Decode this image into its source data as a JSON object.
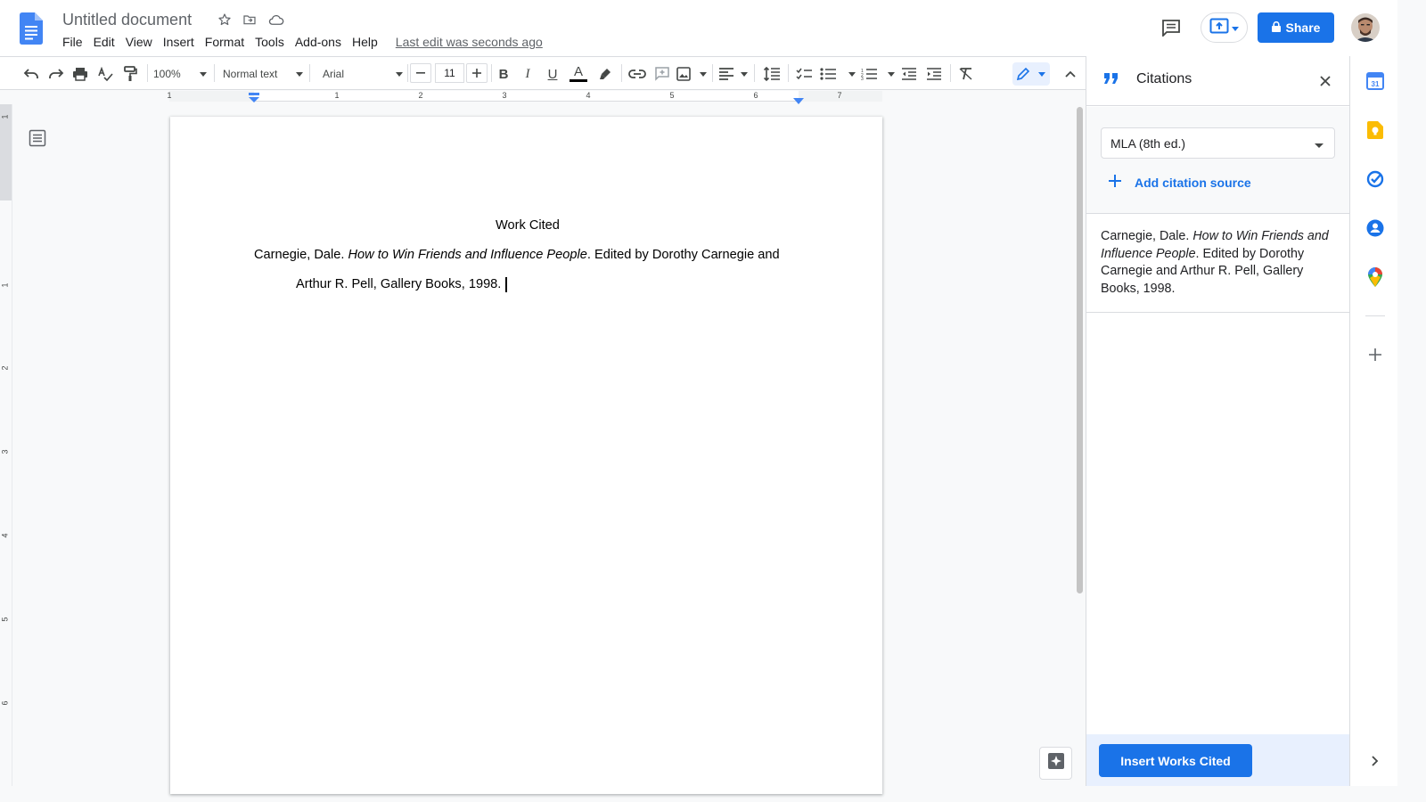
{
  "app": {
    "title": "Untitled document",
    "last_edit": "Last edit was seconds ago"
  },
  "menu": [
    "File",
    "Edit",
    "View",
    "Insert",
    "Format",
    "Tools",
    "Add-ons",
    "Help"
  ],
  "header": {
    "share_label": "Share"
  },
  "toolbar": {
    "zoom": "100%",
    "style": "Normal text",
    "font": "Arial",
    "font_size": "11"
  },
  "ruler": {
    "h_numbers": [
      "1",
      "1",
      "2",
      "3",
      "4",
      "5",
      "6",
      "7"
    ],
    "v_numbers": [
      "1",
      "1",
      "2",
      "3",
      "4",
      "5",
      "6"
    ]
  },
  "document": {
    "heading": "Work Cited",
    "line1_author": "Carnegie, Dale. ",
    "line1_title": "How to Win Friends and Influence People",
    "line1_rest": ". Edited by Dorothy Carnegie and",
    "line2": "Arthur R. Pell, Gallery Books, 1998."
  },
  "citations_panel": {
    "title": "Citations",
    "style_value": "MLA (8th ed.)",
    "add_source_label": "Add citation source",
    "citation_author": "Carnegie, Dale. ",
    "citation_title": "How to Win Friends and Influence People",
    "citation_rest": ". Edited by Dorothy Carnegie and Arthur R. Pell, Gallery Books, 1998.",
    "insert_button": "Insert Works Cited"
  },
  "side_apps": [
    "calendar-icon",
    "keep-icon",
    "tasks-icon",
    "contacts-icon",
    "maps-icon",
    "add-icon",
    "expand-icon"
  ],
  "colors": {
    "accent": "#1a73e8",
    "docs_blue": "#4285f4",
    "panel_footer": "#e8f0fe"
  }
}
